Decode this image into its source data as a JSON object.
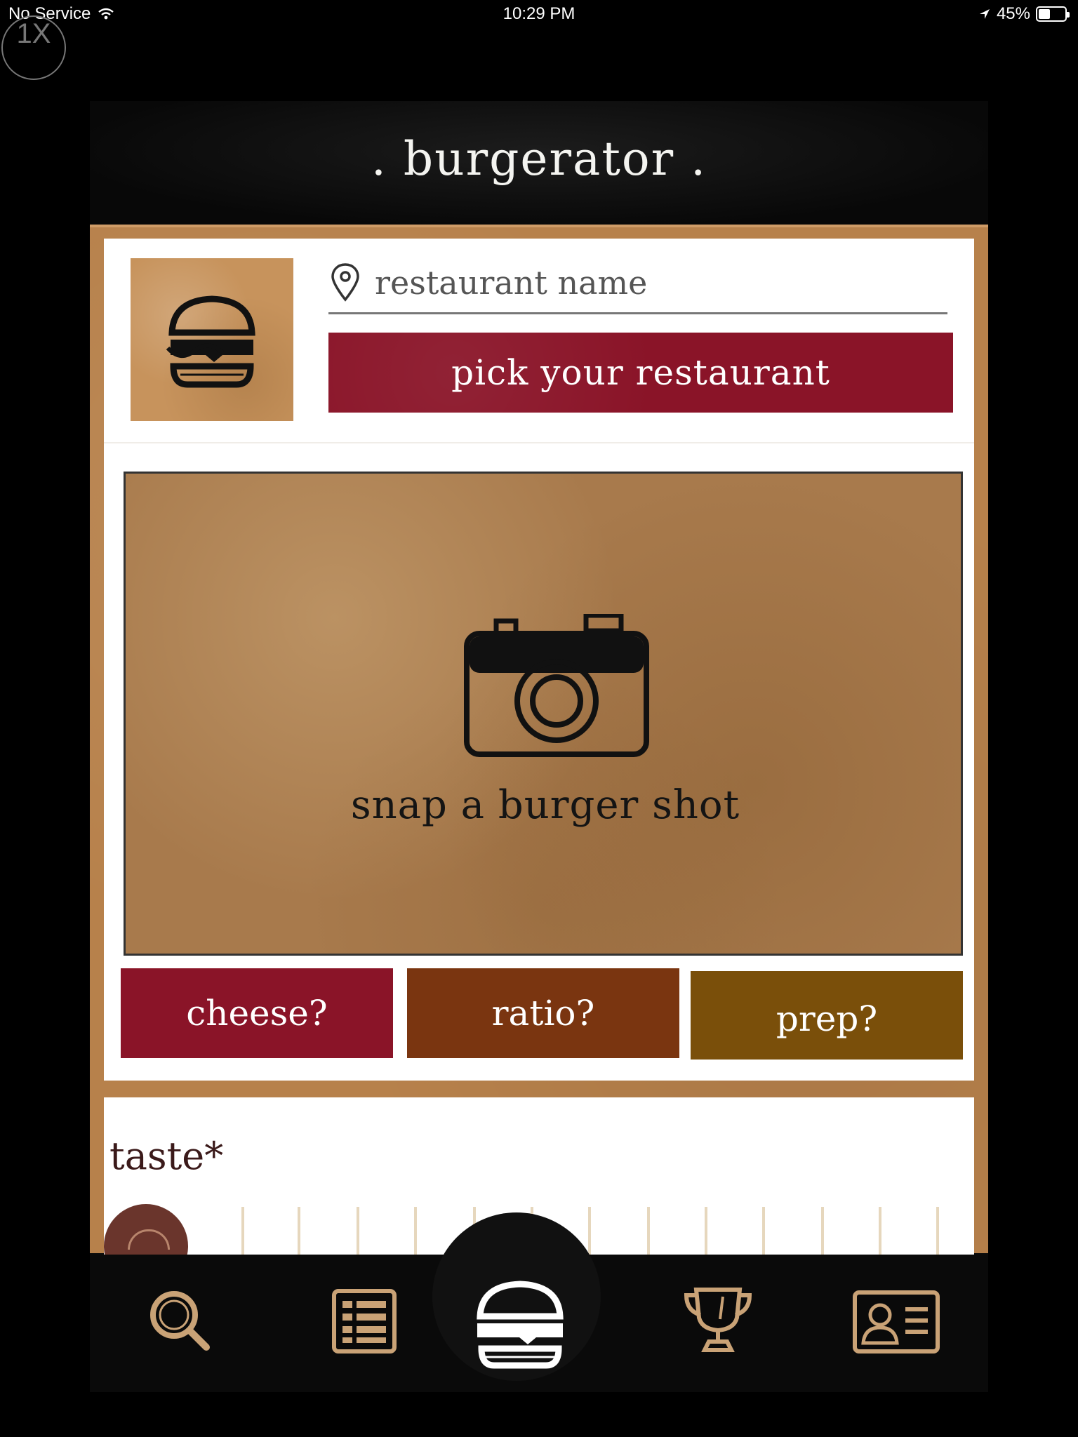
{
  "status_bar": {
    "carrier": "No Service",
    "time": "10:29 PM",
    "battery_percent": "45%",
    "battery_level": 0.45
  },
  "overlay": {
    "zoom_label": "1X"
  },
  "header": {
    "title": ". burgerator ."
  },
  "restaurant": {
    "placeholder": "restaurant name",
    "pick_button_label": "pick your restaurant"
  },
  "photo": {
    "label": "snap a burger shot"
  },
  "tags": [
    {
      "label": "cheese?",
      "color": "#8a1428"
    },
    {
      "label": "ratio?",
      "color": "#7a3510"
    },
    {
      "label": "prep?",
      "color": "#7a4f0a"
    }
  ],
  "taste": {
    "label": "taste*"
  },
  "tabbar": {
    "items": [
      "search-icon",
      "list-icon",
      "burger-icon",
      "trophy-icon",
      "profile-card-icon"
    ],
    "active": "burger-icon",
    "icon_color": "#c9a276",
    "active_color": "#ffffff"
  }
}
